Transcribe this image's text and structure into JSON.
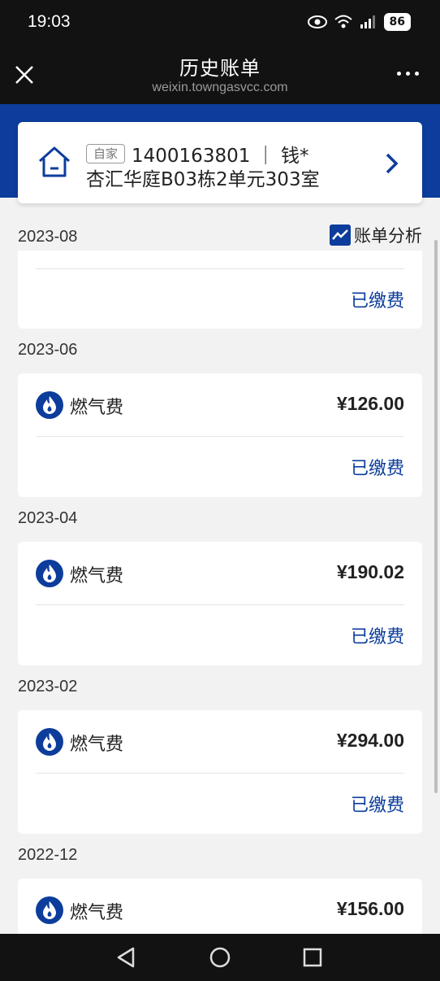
{
  "status_bar": {
    "time": "19:03",
    "battery": "86"
  },
  "nav": {
    "title": "历史账单",
    "subtitle": "weixin.towngasvcc.com"
  },
  "account": {
    "tag": "自家",
    "number_line": "1400163801 ｜ 钱*",
    "address": "杏汇华庭B03栋2单元303室"
  },
  "analysis_label": "账单分析",
  "colors": {
    "brand": "#0c3d9c",
    "background": "#f2f2f2"
  },
  "bills": [
    {
      "month": "2023-08",
      "status": "已缴费"
    },
    {
      "month": "2023-06",
      "name": "燃气费",
      "amount": "¥126.00",
      "status": "已缴费"
    },
    {
      "month": "2023-04",
      "name": "燃气费",
      "amount": "¥190.02",
      "status": "已缴费"
    },
    {
      "month": "2023-02",
      "name": "燃气费",
      "amount": "¥294.00",
      "status": "已缴费"
    },
    {
      "month": "2022-12",
      "name": "燃气费",
      "amount": "¥156.00"
    }
  ]
}
